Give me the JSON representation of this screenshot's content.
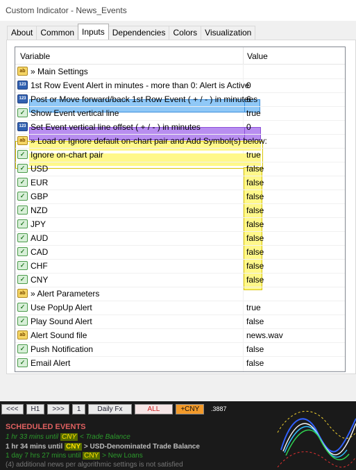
{
  "window": {
    "title": "Custom Indicator - News_Events"
  },
  "tabs": [
    "About",
    "Common",
    "Inputs",
    "Dependencies",
    "Colors",
    "Visualization"
  ],
  "active_tab": "Inputs",
  "grid": {
    "col_variable": "Variable",
    "col_value": "Value",
    "rows": [
      {
        "icon": "ab",
        "label": "» Main Settings",
        "value": ""
      },
      {
        "icon": "123",
        "label": "1st Row Event Alert in minutes - more than 0: Alert is Active",
        "value": "0"
      },
      {
        "icon": "123",
        "label": "Post or Move forward/back 1st Row Event ( + / - ) in minutees",
        "value": "6"
      },
      {
        "icon": "bool",
        "label": "Show Event vertical line",
        "value": "true"
      },
      {
        "icon": "123",
        "label": "Set Event vertical line offset ( + / - ) in minutes",
        "value": "0"
      },
      {
        "icon": "ab",
        "label": "» Load or Ignore default on-chart pair and Add Symbol(s) below:",
        "value": ""
      },
      {
        "icon": "bool",
        "label": "Ignore on-chart pair",
        "value": "true"
      },
      {
        "icon": "bool",
        "label": "USD",
        "value": "false"
      },
      {
        "icon": "bool",
        "label": "EUR",
        "value": "false"
      },
      {
        "icon": "bool",
        "label": "GBP",
        "value": "false"
      },
      {
        "icon": "bool",
        "label": "NZD",
        "value": "false"
      },
      {
        "icon": "bool",
        "label": "JPY",
        "value": "false"
      },
      {
        "icon": "bool",
        "label": "AUD",
        "value": "false"
      },
      {
        "icon": "bool",
        "label": "CAD",
        "value": "false"
      },
      {
        "icon": "bool",
        "label": "CHF",
        "value": "false"
      },
      {
        "icon": "bool",
        "label": "CNY",
        "value": "false"
      },
      {
        "icon": "ab",
        "label": "» Alert Parameters",
        "value": ""
      },
      {
        "icon": "bool",
        "label": "Use PopUp Alert",
        "value": "true"
      },
      {
        "icon": "bool",
        "label": "Play Sound Alert",
        "value": "false"
      },
      {
        "icon": "ab",
        "label": "Alert Sound file",
        "value": "news.wav"
      },
      {
        "icon": "bool",
        "label": "Push Notification",
        "value": "false"
      },
      {
        "icon": "bool",
        "label": "Email Alert",
        "value": "false"
      }
    ]
  },
  "chart": {
    "buttons": [
      "<<<",
      "H1",
      ">>>",
      "1",
      "Daily Fx",
      "ALL",
      "+CNY"
    ],
    "price": ".3887",
    "events_title": "SCHEDULED EVENTS",
    "events": [
      {
        "pre": "1 hr 33 mins until ",
        "cur": "CNY",
        "post": " <  Trade Balance"
      },
      {
        "pre": "1 hr 34 mins until ",
        "cur": "CNY",
        "post": " >  USD-Denominated Trade Balance"
      },
      {
        "pre": "1 day 7 hrs 27 mins until ",
        "cur": "CNY",
        "post": " >  New Loans"
      }
    ],
    "footer": "(4) additional news per algorithmic settings is not satisfied",
    "colors": {
      "background": "#1a1a1a",
      "title": "#e06060",
      "active": "#2c9a2c"
    }
  }
}
